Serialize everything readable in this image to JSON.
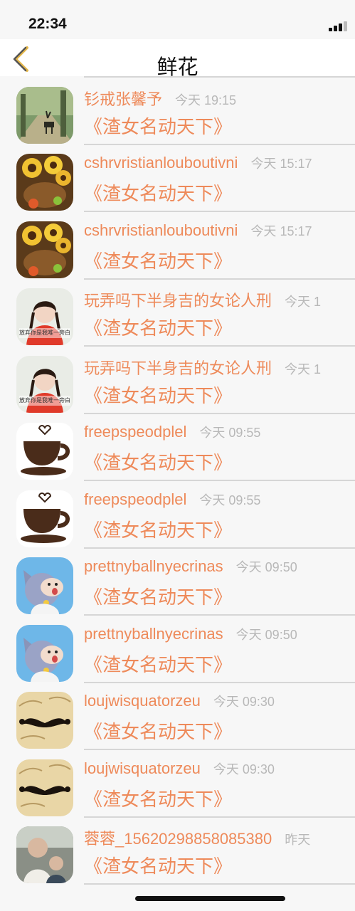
{
  "status_bar": {
    "time": "22:34"
  },
  "navbar": {
    "title": "鲜花"
  },
  "items": [
    {
      "name": "",
      "time": "",
      "message": "《渣女名动天下》",
      "avatar": "deer-forest"
    },
    {
      "name": "钐戒张馨予",
      "time": "今天 19:15",
      "message": "《渣女名动天下》",
      "avatar": "deer-forest"
    },
    {
      "name": "cshrvristianlouboutivni",
      "time": "今天 15:17",
      "message": "《渣女名动天下》",
      "avatar": "sunflowers"
    },
    {
      "name": "cshrvristianlouboutivni",
      "time": "今天 15:17",
      "message": "《渣女名动天下》",
      "avatar": "sunflowers"
    },
    {
      "name": "玩弄吗下半身吉的女论人刑",
      "time": "今天 1",
      "message": "《渣女名动天下》",
      "avatar": "girl-red",
      "avatar_caption": "放弃你是我唯一旁白"
    },
    {
      "name": "玩弄吗下半身吉的女论人刑",
      "time": "今天 1",
      "message": "《渣女名动天下》",
      "avatar": "girl-red",
      "avatar_caption": "放弃你是我唯一旁白"
    },
    {
      "name": "freepspeodplel",
      "time": "今天 09:55",
      "message": "《渣女名动天下》",
      "avatar": "coffee-cup"
    },
    {
      "name": "freepspeodplel",
      "time": "今天 09:55",
      "message": "《渣女名动天下》",
      "avatar": "coffee-cup"
    },
    {
      "name": "prettnyballnyecrinas",
      "time": "今天 09:50",
      "message": "《渣女名动天下》",
      "avatar": "cartoon-cat"
    },
    {
      "name": "prettnyballnyecrinas",
      "time": "今天 09:50",
      "message": "《渣女名动天下》",
      "avatar": "cartoon-cat"
    },
    {
      "name": "loujwisquatorzeu",
      "time": "今天 09:30",
      "message": "《渣女名动天下》",
      "avatar": "mustache"
    },
    {
      "name": "loujwisquatorzeu",
      "time": "今天 09:30",
      "message": "《渣女名动天下》",
      "avatar": "mustache"
    },
    {
      "name": "蓉蓉_15620298858085380",
      "time": "昨天",
      "message": "《渣女名动天下》",
      "avatar": "children-photo"
    }
  ],
  "colors": {
    "accent": "#ee8a5a",
    "time_gray": "#b8b8b8",
    "divider": "#d6d6d6",
    "background": "#f7f7f7"
  }
}
